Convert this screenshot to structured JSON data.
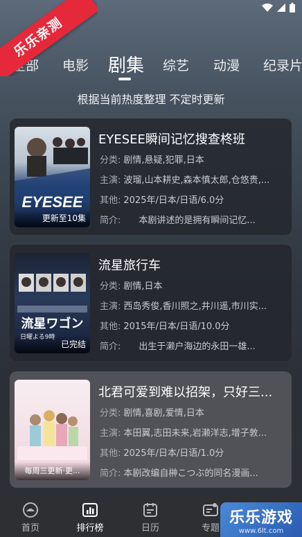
{
  "ribbon": "乐乐亲测",
  "tabs": [
    {
      "label": "全部"
    },
    {
      "label": "电影"
    },
    {
      "label": "剧集"
    },
    {
      "label": "综艺"
    },
    {
      "label": "动漫"
    },
    {
      "label": "纪录片"
    }
  ],
  "active_tab": "剧集",
  "subtitle": "根据当前热度整理 不定时更新",
  "meta_keys": {
    "category": "分类:",
    "cast": "主演:",
    "other": "其他:",
    "intro": "简介:"
  },
  "items": [
    {
      "title": "EYESEE瞬间记忆搜查柊班",
      "badge": "更新至10集",
      "poster_text": "EYESEE",
      "category": "剧情,悬疑,犯罪,日本",
      "cast": "波瑠,山本耕史,森本慎太郎,仓悠贵,...",
      "other": "2025年/日本/日语/6.0分",
      "intro": "本剧讲述的是拥有瞬间记忆..."
    },
    {
      "title": "流星旅行车",
      "badge": "已完结",
      "poster_text": "流星ワゴン",
      "poster_sub": "日曜よる9時",
      "category": "剧情,日本",
      "cast": "西岛秀俊,香川照之,井川遥,市川实...",
      "other": "2015年/日本/日语/10.0分",
      "intro": "出生于濑户海边的永田一雄..."
    },
    {
      "title": "北君可爱到难以招架，只好三...",
      "badge": "每周三更新·更...",
      "category": "剧情,喜剧,爱情,日本",
      "cast": "本田翼,志田未来,岩濑洋志,增子敦...",
      "other": "2025年/日本/日语/1.0分",
      "intro": "本剧改编自榊こつぶ的同名漫画..."
    }
  ],
  "bottom_nav": [
    {
      "label": "首页",
      "icon": "home-icon"
    },
    {
      "label": "排行榜",
      "icon": "ranking-icon"
    },
    {
      "label": "日历",
      "icon": "calendar-icon"
    },
    {
      "label": "专题",
      "icon": "topic-icon"
    }
  ],
  "watermark": {
    "title": "乐乐游戏",
    "sub": "www.6lt.com"
  }
}
